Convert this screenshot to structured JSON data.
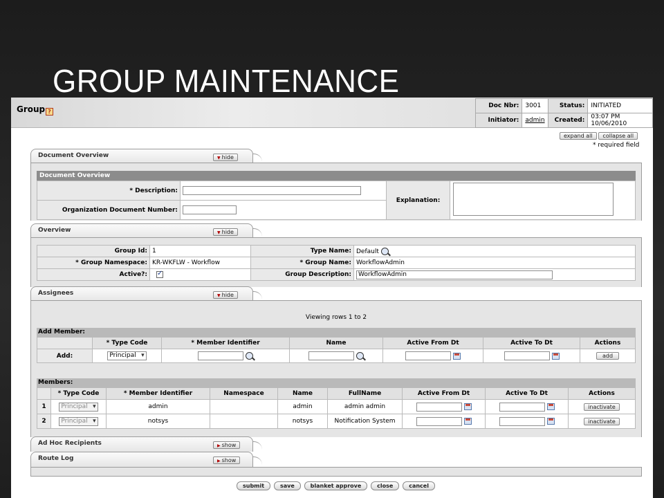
{
  "slide": {
    "title": "GROUP MAINTENANCE"
  },
  "header": {
    "title": "Group",
    "help": "?",
    "doc_nbr_label": "Doc Nbr:",
    "doc_nbr": "3001",
    "status_label": "Status:",
    "status": "INITIATED",
    "initiator_label": "Initiator:",
    "initiator": "admin",
    "created_label": "Created:",
    "created": "03:07 PM 10/06/2010"
  },
  "controls": {
    "expand_all": "expand all",
    "collapse_all": "collapse all",
    "required_note": "* required field"
  },
  "document_overview": {
    "tab_label": "Document Overview",
    "toggle": "hide",
    "section_title": "Document Overview",
    "description_label": "* Description:",
    "description": "",
    "org_doc_number_label": "Organization Document Number:",
    "org_doc_number": "",
    "explanation_label": "Explanation:",
    "explanation": ""
  },
  "overview": {
    "tab_label": "Overview",
    "toggle": "hide",
    "group_id_label": "Group Id:",
    "group_id": "1",
    "type_name_label": "Type Name:",
    "type_name": "Default",
    "namespace_label": "* Group Namespace:",
    "namespace": "KR-WKFLW - Workflow",
    "group_name_label": "* Group Name:",
    "group_name": "WorkflowAdmin",
    "active_label": "Active?:",
    "group_desc_label": "Group Description:",
    "group_desc": "WorkflowAdmin"
  },
  "assignees": {
    "tab_label": "Assignees",
    "toggle": "hide",
    "viewing": "Viewing rows 1 to 2",
    "add_member": {
      "title": "Add Member:",
      "columns": [
        "* Type Code",
        "* Member Identifier",
        "Name",
        "Active From Dt",
        "Active To Dt",
        "Actions"
      ],
      "row_label": "Add:",
      "type_code": "Principal",
      "action": "add"
    },
    "members": {
      "title": "Members:",
      "columns": [
        "* Type Code",
        "* Member Identifier",
        "Namespace",
        "Name",
        "FullName",
        "Active From Dt",
        "Active To Dt",
        "Actions"
      ],
      "rows": [
        {
          "num": "1",
          "type_code": "Principal",
          "member_id": "admin",
          "namespace": "",
          "name": "admin",
          "full_name": "admin admin",
          "action": "inactivate"
        },
        {
          "num": "2",
          "type_code": "Principal",
          "member_id": "notsys",
          "namespace": "",
          "name": "notsys",
          "full_name": "Notification System",
          "action": "inactivate"
        }
      ]
    }
  },
  "ad_hoc": {
    "tab_label": "Ad Hoc Recipients",
    "toggle": "show"
  },
  "route_log": {
    "tab_label": "Route Log",
    "toggle": "show"
  },
  "actions": {
    "submit": "submit",
    "save": "save",
    "blanket_approve": "blanket approve",
    "close": "close",
    "cancel": "cancel"
  }
}
